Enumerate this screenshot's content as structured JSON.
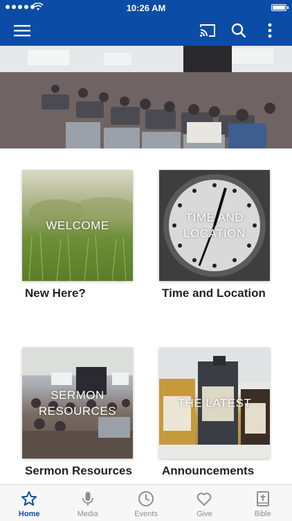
{
  "status_bar": {
    "time": "10:26 AM"
  },
  "tiles": [
    {
      "overlay": "WELCOME",
      "caption": "New Here?"
    },
    {
      "overlay": "TIME AND LOCATION",
      "caption": "Time and Location"
    },
    {
      "overlay": "SERMON RESOURCES",
      "caption": "Sermon Resources"
    },
    {
      "overlay": "THE LATEST",
      "caption": "Announcements"
    }
  ],
  "tabs": [
    {
      "label": "Home",
      "icon": "star-icon",
      "active": true
    },
    {
      "label": "Media",
      "icon": "microphone-icon"
    },
    {
      "label": "Events",
      "icon": "clock-icon"
    },
    {
      "label": "Give",
      "icon": "heart-icon"
    },
    {
      "label": "Bible",
      "icon": "bible-icon"
    }
  ],
  "colors": {
    "primary": "#0b4ca6",
    "inactive": "#8e8e93"
  }
}
